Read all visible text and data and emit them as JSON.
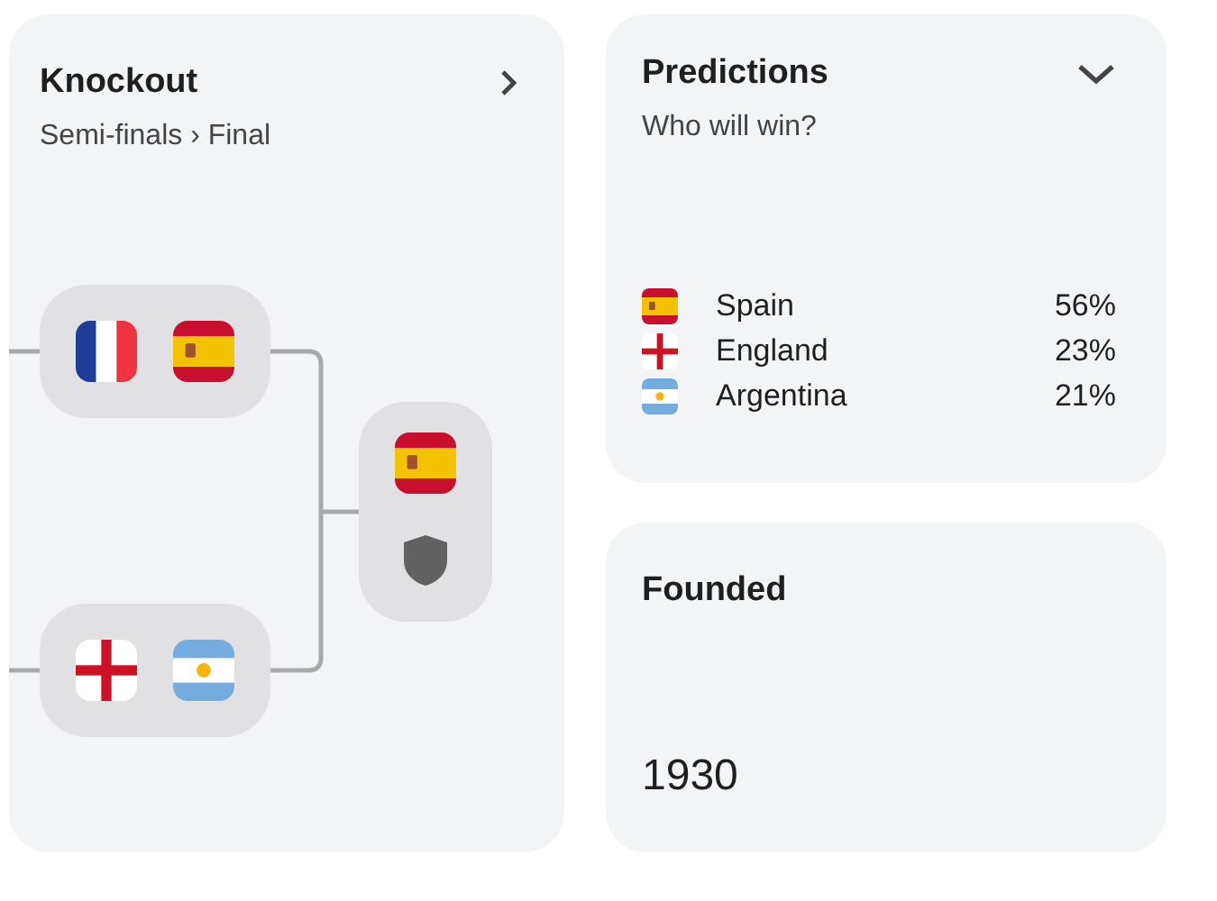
{
  "knockout": {
    "title": "Knockout",
    "subtitle": "Semi-finals › Final",
    "bracket": {
      "semifinals": [
        {
          "teams": [
            {
              "kind": "fr"
            },
            {
              "kind": "es"
            }
          ]
        },
        {
          "teams": [
            {
              "kind": "en"
            },
            {
              "kind": "ar"
            }
          ]
        }
      ],
      "final": {
        "teams": [
          {
            "kind": "es"
          },
          {
            "kind": "tbd"
          }
        ]
      }
    }
  },
  "predictions": {
    "title": "Predictions",
    "subtitle": "Who will win?",
    "rows": [
      {
        "kind": "es",
        "team": "Spain",
        "share": "56%"
      },
      {
        "kind": "en",
        "team": "England",
        "share": "23%"
      },
      {
        "kind": "ar",
        "team": "Argentina",
        "share": "21%"
      }
    ]
  },
  "founded": {
    "title": "Founded",
    "value": "1930"
  }
}
